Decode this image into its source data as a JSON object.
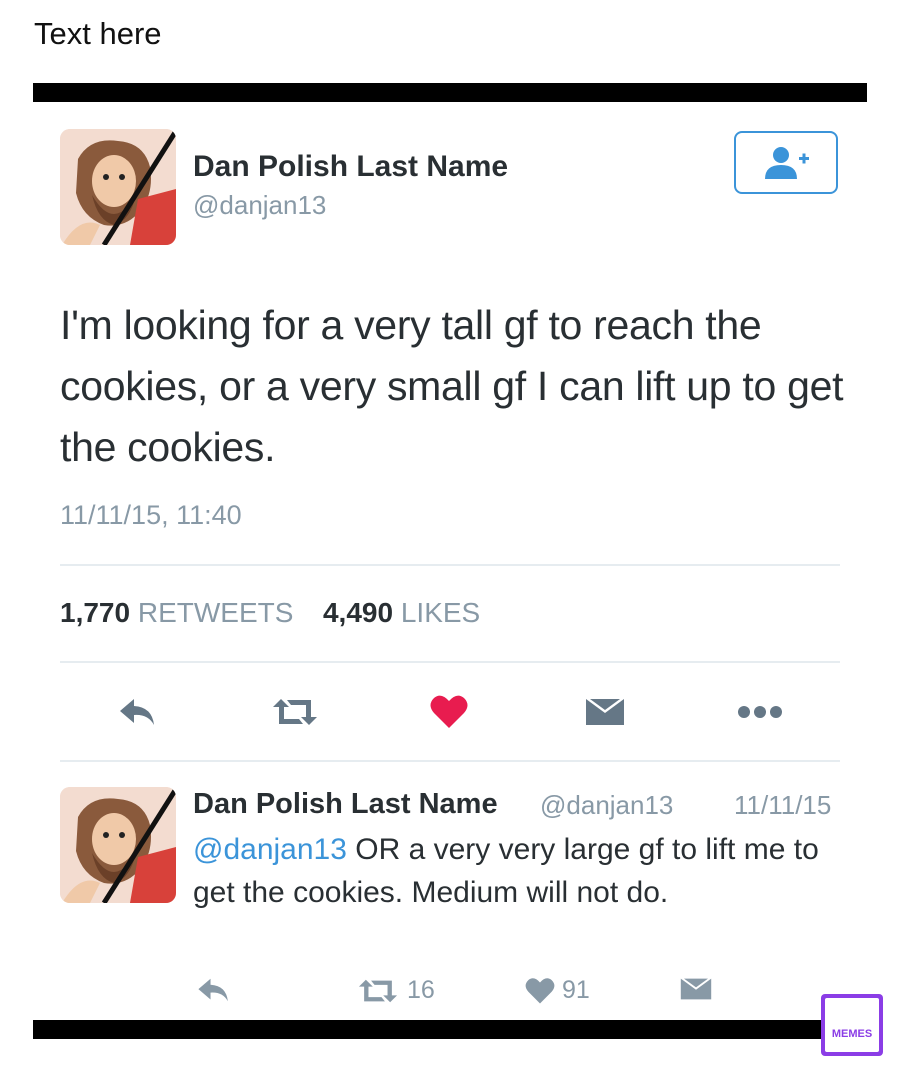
{
  "caption": "Text here",
  "tweet": {
    "author_name": "Dan Polish Last Name",
    "author_handle": "@danjan13",
    "text": "I'm looking for a very tall gf to reach the cookies, or a very small gf I can lift up to get the cookies.",
    "timestamp": "11/11/15, 11:40",
    "retweets_count": "1,770",
    "retweets_label": "RETWEETS",
    "likes_count": "4,490",
    "likes_label": "LIKES",
    "actions": [
      "reply-icon",
      "retweet-icon",
      "heart-icon",
      "dm-icon",
      "more-icon"
    ],
    "liked_color": "#e81c4f",
    "follow_button_icon": "follow-user-icon"
  },
  "reply": {
    "author_name": "Dan Polish Last Name",
    "author_handle": "@danjan13",
    "date": "11/11/15",
    "mention": "@danjan13",
    "text": "OR a very very large gf to lift me to get the cookies. Medium will not do.",
    "retweets_count": "16",
    "likes_count": "91"
  },
  "watermark": {
    "label": "MEMES",
    "color": "#8b3de6"
  },
  "colors": {
    "accent": "#3b94d9",
    "muted_text": "#8899a6",
    "divider": "#e6ecf0"
  }
}
